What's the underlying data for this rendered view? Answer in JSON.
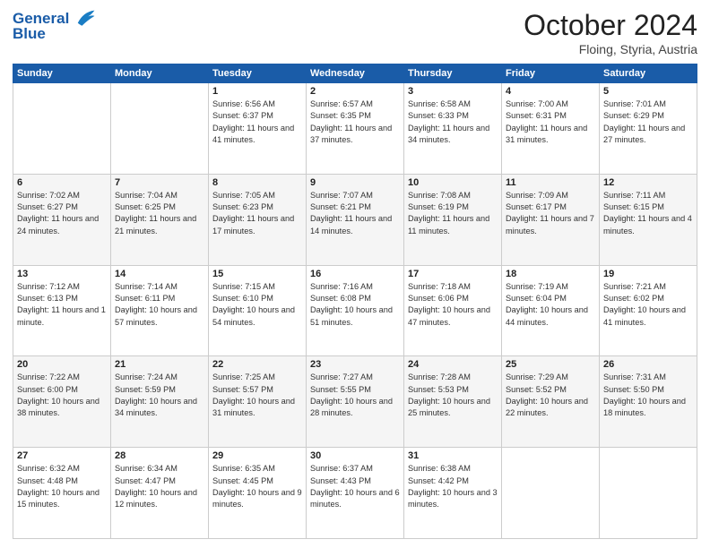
{
  "header": {
    "logo_line1": "General",
    "logo_line2": "Blue",
    "title": "October 2024",
    "location": "Floing, Styria, Austria"
  },
  "weekdays": [
    "Sunday",
    "Monday",
    "Tuesday",
    "Wednesday",
    "Thursday",
    "Friday",
    "Saturday"
  ],
  "weeks": [
    [
      {
        "day": "",
        "sunrise": "",
        "sunset": "",
        "daylight": ""
      },
      {
        "day": "",
        "sunrise": "",
        "sunset": "",
        "daylight": ""
      },
      {
        "day": "1",
        "sunrise": "Sunrise: 6:56 AM",
        "sunset": "Sunset: 6:37 PM",
        "daylight": "Daylight: 11 hours and 41 minutes."
      },
      {
        "day": "2",
        "sunrise": "Sunrise: 6:57 AM",
        "sunset": "Sunset: 6:35 PM",
        "daylight": "Daylight: 11 hours and 37 minutes."
      },
      {
        "day": "3",
        "sunrise": "Sunrise: 6:58 AM",
        "sunset": "Sunset: 6:33 PM",
        "daylight": "Daylight: 11 hours and 34 minutes."
      },
      {
        "day": "4",
        "sunrise": "Sunrise: 7:00 AM",
        "sunset": "Sunset: 6:31 PM",
        "daylight": "Daylight: 11 hours and 31 minutes."
      },
      {
        "day": "5",
        "sunrise": "Sunrise: 7:01 AM",
        "sunset": "Sunset: 6:29 PM",
        "daylight": "Daylight: 11 hours and 27 minutes."
      }
    ],
    [
      {
        "day": "6",
        "sunrise": "Sunrise: 7:02 AM",
        "sunset": "Sunset: 6:27 PM",
        "daylight": "Daylight: 11 hours and 24 minutes."
      },
      {
        "day": "7",
        "sunrise": "Sunrise: 7:04 AM",
        "sunset": "Sunset: 6:25 PM",
        "daylight": "Daylight: 11 hours and 21 minutes."
      },
      {
        "day": "8",
        "sunrise": "Sunrise: 7:05 AM",
        "sunset": "Sunset: 6:23 PM",
        "daylight": "Daylight: 11 hours and 17 minutes."
      },
      {
        "day": "9",
        "sunrise": "Sunrise: 7:07 AM",
        "sunset": "Sunset: 6:21 PM",
        "daylight": "Daylight: 11 hours and 14 minutes."
      },
      {
        "day": "10",
        "sunrise": "Sunrise: 7:08 AM",
        "sunset": "Sunset: 6:19 PM",
        "daylight": "Daylight: 11 hours and 11 minutes."
      },
      {
        "day": "11",
        "sunrise": "Sunrise: 7:09 AM",
        "sunset": "Sunset: 6:17 PM",
        "daylight": "Daylight: 11 hours and 7 minutes."
      },
      {
        "day": "12",
        "sunrise": "Sunrise: 7:11 AM",
        "sunset": "Sunset: 6:15 PM",
        "daylight": "Daylight: 11 hours and 4 minutes."
      }
    ],
    [
      {
        "day": "13",
        "sunrise": "Sunrise: 7:12 AM",
        "sunset": "Sunset: 6:13 PM",
        "daylight": "Daylight: 11 hours and 1 minute."
      },
      {
        "day": "14",
        "sunrise": "Sunrise: 7:14 AM",
        "sunset": "Sunset: 6:11 PM",
        "daylight": "Daylight: 10 hours and 57 minutes."
      },
      {
        "day": "15",
        "sunrise": "Sunrise: 7:15 AM",
        "sunset": "Sunset: 6:10 PM",
        "daylight": "Daylight: 10 hours and 54 minutes."
      },
      {
        "day": "16",
        "sunrise": "Sunrise: 7:16 AM",
        "sunset": "Sunset: 6:08 PM",
        "daylight": "Daylight: 10 hours and 51 minutes."
      },
      {
        "day": "17",
        "sunrise": "Sunrise: 7:18 AM",
        "sunset": "Sunset: 6:06 PM",
        "daylight": "Daylight: 10 hours and 47 minutes."
      },
      {
        "day": "18",
        "sunrise": "Sunrise: 7:19 AM",
        "sunset": "Sunset: 6:04 PM",
        "daylight": "Daylight: 10 hours and 44 minutes."
      },
      {
        "day": "19",
        "sunrise": "Sunrise: 7:21 AM",
        "sunset": "Sunset: 6:02 PM",
        "daylight": "Daylight: 10 hours and 41 minutes."
      }
    ],
    [
      {
        "day": "20",
        "sunrise": "Sunrise: 7:22 AM",
        "sunset": "Sunset: 6:00 PM",
        "daylight": "Daylight: 10 hours and 38 minutes."
      },
      {
        "day": "21",
        "sunrise": "Sunrise: 7:24 AM",
        "sunset": "Sunset: 5:59 PM",
        "daylight": "Daylight: 10 hours and 34 minutes."
      },
      {
        "day": "22",
        "sunrise": "Sunrise: 7:25 AM",
        "sunset": "Sunset: 5:57 PM",
        "daylight": "Daylight: 10 hours and 31 minutes."
      },
      {
        "day": "23",
        "sunrise": "Sunrise: 7:27 AM",
        "sunset": "Sunset: 5:55 PM",
        "daylight": "Daylight: 10 hours and 28 minutes."
      },
      {
        "day": "24",
        "sunrise": "Sunrise: 7:28 AM",
        "sunset": "Sunset: 5:53 PM",
        "daylight": "Daylight: 10 hours and 25 minutes."
      },
      {
        "day": "25",
        "sunrise": "Sunrise: 7:29 AM",
        "sunset": "Sunset: 5:52 PM",
        "daylight": "Daylight: 10 hours and 22 minutes."
      },
      {
        "day": "26",
        "sunrise": "Sunrise: 7:31 AM",
        "sunset": "Sunset: 5:50 PM",
        "daylight": "Daylight: 10 hours and 18 minutes."
      }
    ],
    [
      {
        "day": "27",
        "sunrise": "Sunrise: 6:32 AM",
        "sunset": "Sunset: 4:48 PM",
        "daylight": "Daylight: 10 hours and 15 minutes."
      },
      {
        "day": "28",
        "sunrise": "Sunrise: 6:34 AM",
        "sunset": "Sunset: 4:47 PM",
        "daylight": "Daylight: 10 hours and 12 minutes."
      },
      {
        "day": "29",
        "sunrise": "Sunrise: 6:35 AM",
        "sunset": "Sunset: 4:45 PM",
        "daylight": "Daylight: 10 hours and 9 minutes."
      },
      {
        "day": "30",
        "sunrise": "Sunrise: 6:37 AM",
        "sunset": "Sunset: 4:43 PM",
        "daylight": "Daylight: 10 hours and 6 minutes."
      },
      {
        "day": "31",
        "sunrise": "Sunrise: 6:38 AM",
        "sunset": "Sunset: 4:42 PM",
        "daylight": "Daylight: 10 hours and 3 minutes."
      },
      {
        "day": "",
        "sunrise": "",
        "sunset": "",
        "daylight": ""
      },
      {
        "day": "",
        "sunrise": "",
        "sunset": "",
        "daylight": ""
      }
    ]
  ]
}
